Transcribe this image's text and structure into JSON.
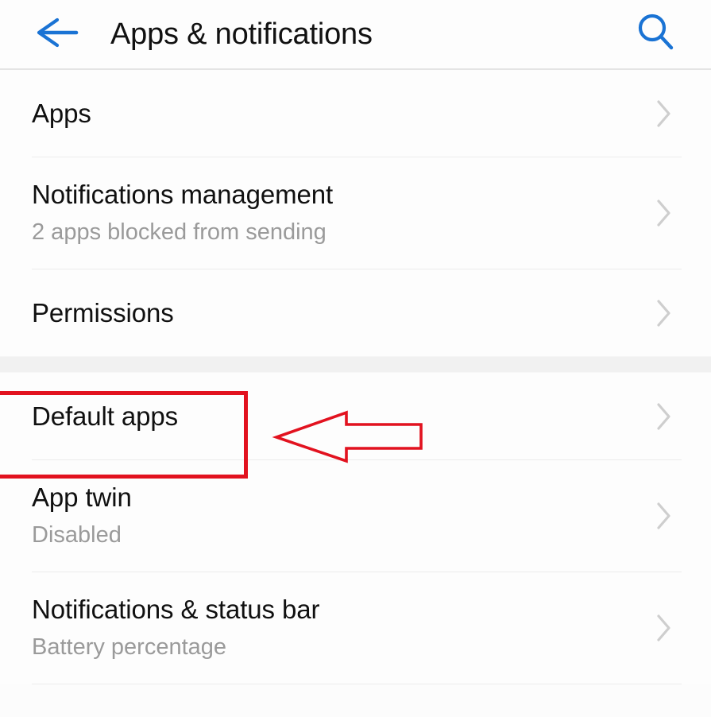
{
  "header": {
    "title": "Apps & notifications",
    "back_icon": "back-arrow-icon",
    "search_icon": "search-icon",
    "icon_color": "#1a73d4"
  },
  "sections": [
    {
      "id": "section-one",
      "rows": [
        {
          "title": "Apps",
          "subtitle": "",
          "chevron": "chevron-right-icon"
        },
        {
          "title": "Notifications management",
          "subtitle": "2 apps blocked from sending",
          "chevron": "chevron-right-icon"
        },
        {
          "title": "Permissions",
          "subtitle": "",
          "chevron": "chevron-right-icon"
        }
      ]
    },
    {
      "id": "section-two",
      "rows": [
        {
          "title": "Default apps",
          "subtitle": "",
          "chevron": "chevron-right-icon"
        },
        {
          "title": "App twin",
          "subtitle": "Disabled",
          "chevron": "chevron-right-icon"
        },
        {
          "title": "Notifications & status bar",
          "subtitle": "Battery percentage",
          "chevron": "chevron-right-icon"
        }
      ]
    }
  ],
  "annotations": {
    "highlight_box": {
      "target": "Default apps",
      "color": "#e2121f"
    },
    "pointer_arrow": {
      "direction": "left",
      "target": "Default apps",
      "color": "#e2121f"
    }
  }
}
